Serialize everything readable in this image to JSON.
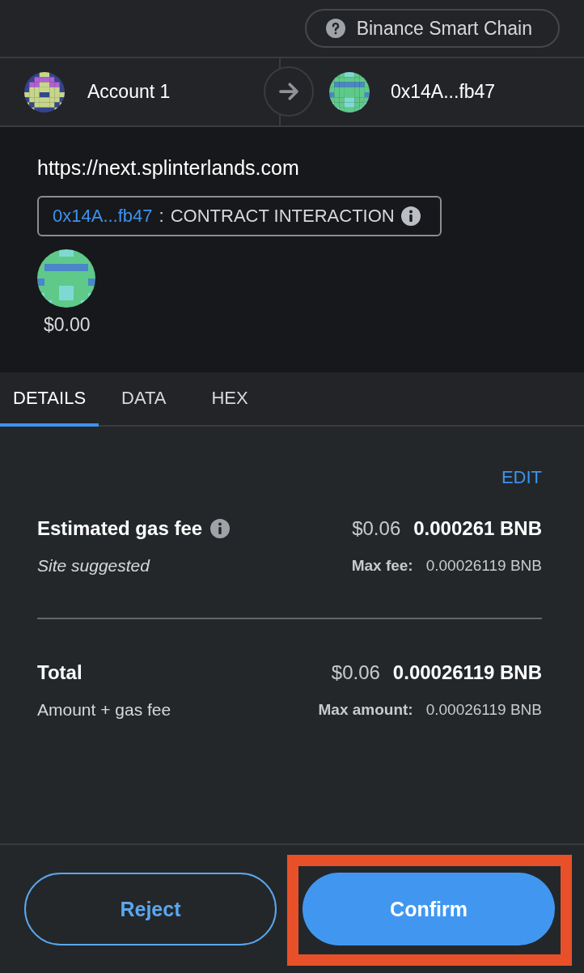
{
  "network": {
    "name": "Binance Smart Chain"
  },
  "from": {
    "name": "Account 1"
  },
  "to": {
    "name": "0x14A...fb47"
  },
  "origin": "https://next.splinterlands.com",
  "contract": {
    "address": "0x14A...fb47",
    "separator": ":",
    "label": "CONTRACT INTERACTION"
  },
  "value": "$0.00",
  "tabs": [
    {
      "label": "DETAILS",
      "selected": true
    },
    {
      "label": "DATA",
      "selected": false
    },
    {
      "label": "HEX",
      "selected": false
    }
  ],
  "edit_link": "EDIT",
  "gas": {
    "label": "Estimated gas fee",
    "fiat": "$0.06",
    "amount": "0.000261 BNB",
    "note": "Site suggested",
    "max_label": "Max fee:",
    "max_value": "0.00026119 BNB"
  },
  "total": {
    "label": "Total",
    "fiat": "$0.06",
    "amount": "0.00026119 BNB",
    "note": "Amount + gas fee",
    "max_label": "Max amount:",
    "max_value": "0.00026119 BNB"
  },
  "buttons": [
    {
      "label": "Reject",
      "kind": "secondary",
      "highlighted": false
    },
    {
      "label": "Confirm",
      "kind": "primary",
      "highlighted": true
    }
  ]
}
